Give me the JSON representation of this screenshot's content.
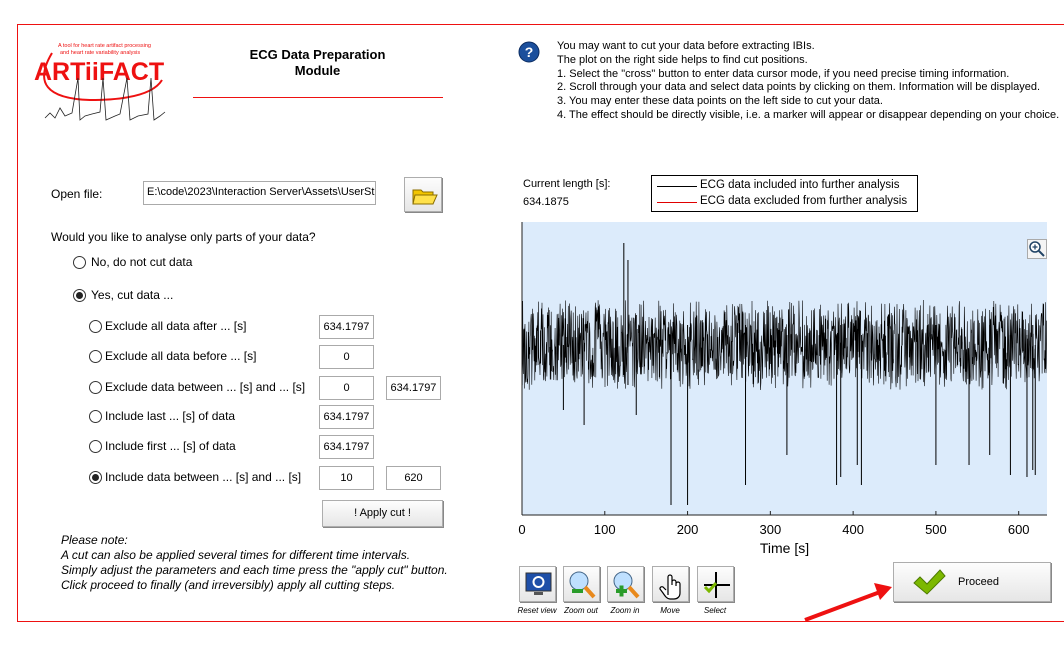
{
  "logo": {
    "name": "ARTiiFACT",
    "tagline": "A tool for heart rate artifact processing and heart rate variability analysis"
  },
  "header": {
    "title_line1": "ECG Data Preparation",
    "title_line2": "Module"
  },
  "help": {
    "lines": [
      "You may want to cut your data before extracting IBIs.",
      "The plot on the right side helps to find cut positions.",
      "1. Select the \"cross\" button to enter data cursor mode, if you need precise timing information.",
      "2. Scroll through your data and select data points by clicking on them. Information will be displayed.",
      "3. You may enter these data points on the left side to cut your data.",
      "4. The effect should be directly visible, i.e. a marker will appear or disappear depending on your choice."
    ]
  },
  "file": {
    "label": "Open file:",
    "value": "E:\\code\\2023\\Interaction Server\\Assets\\UserStu"
  },
  "question": "Would you like to analyse only parts of your data?",
  "options": {
    "no": "No, do not cut data",
    "yes": "Yes, cut data ..."
  },
  "cut_options": [
    {
      "label": "Exclude all data after ... [s]",
      "v1": "634.1797",
      "selected": false
    },
    {
      "label": "Exclude all data before ... [s]",
      "v1": "0",
      "selected": false
    },
    {
      "label": "Exclude data between ... [s] and ... [s]",
      "v1": "0",
      "v2": "634.1797",
      "selected": false
    },
    {
      "label": "Include last ... [s] of data",
      "v1": "634.1797",
      "selected": false
    },
    {
      "label": "Include first ... [s] of data",
      "v1": "634.1797",
      "selected": false
    },
    {
      "label": "Include data between ... [s] and ... [s]",
      "v1": "10",
      "v2": "620",
      "selected": true
    }
  ],
  "apply_cut": "!   Apply cut   !",
  "note": {
    "lines": [
      "Please note:",
      "A cut can also be applied several times for different time intervals.",
      "Simply adjust the parameters and each time press the \"apply cut\" button.",
      "Click proceed to finally (and irreversibly) apply all cutting steps."
    ]
  },
  "current_length": {
    "label": "Current length [s]:",
    "value": "634.1875"
  },
  "toolbar": [
    {
      "label": "Reset view",
      "icon": "monitor-reset-icon"
    },
    {
      "label": "Zoom out",
      "icon": "zoom-out-icon"
    },
    {
      "label": "Zoom in",
      "icon": "zoom-in-icon"
    },
    {
      "label": "Move",
      "icon": "hand-icon"
    },
    {
      "label": "Select",
      "icon": "crosshair-icon"
    }
  ],
  "proceed": "Proceed",
  "colors": {
    "accent": "#e11d1d",
    "plot_bg": "#dcebfb",
    "included": "#000000",
    "excluded": "#e00000",
    "check": "#7cb800"
  },
  "chart_data": {
    "type": "line",
    "xlabel": "Time [s]",
    "ylabel": "",
    "xlim": [
      0,
      634.1875
    ],
    "xticks": [
      0,
      100,
      200,
      300,
      400,
      500,
      600
    ],
    "legend": {
      "position": "top",
      "entries": [
        {
          "name": "ECG data included into further analysis",
          "color": "#000000"
        },
        {
          "name": "ECG data excluded from further analysis",
          "color": "#e00000"
        }
      ]
    },
    "grid": false
  }
}
